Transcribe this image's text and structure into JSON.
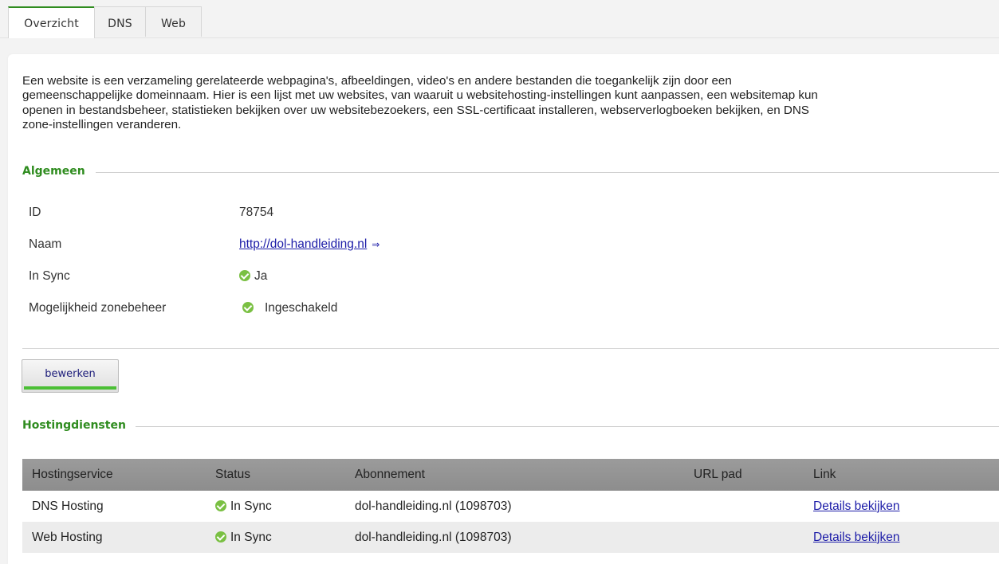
{
  "tabs": [
    "Overzicht",
    "DNS",
    "Web"
  ],
  "description": [
    "Een website is een verzameling gerelateerde webpagina's, afbeeldingen, video's en andere bestanden die toegankelijk zijn door een",
    "gemeenschappelijke domeinnaam. Hier is een lijst met uw websites, van waaruit u websitehosting-instellingen kunt aanpassen, een websitemap kun",
    "openen in bestandsbeheer, statistieken bekijken over uw websitebezoekers, een SSL-certificaat installeren, webserverlogboeken bekijken, en DNS",
    "zone-instellingen veranderen."
  ],
  "general": {
    "title": "Algemeen",
    "id_label": "ID",
    "id_value": "78754",
    "name_label": "Naam",
    "name_value": "http://dol-handleiding.nl",
    "sync_label": "In Sync",
    "sync_value": "Ja",
    "zone_label": "Mogelijkheid zonebeheer",
    "zone_value": "Ingeschakeld"
  },
  "edit_button": "bewerken",
  "hosting": {
    "title": "Hostingdiensten",
    "headers": [
      "Hostingservice",
      "Status",
      "Abonnement",
      "URL pad",
      "Link"
    ],
    "rows": [
      {
        "service": "DNS Hosting",
        "status": "In Sync",
        "subscription": "dol-handleiding.nl (1098703)",
        "url_path": "",
        "link": "Details bekijken"
      },
      {
        "service": "Web Hosting",
        "status": "In Sync",
        "subscription": "dol-handleiding.nl (1098703)",
        "url_path": "",
        "link": "Details bekijken"
      }
    ]
  },
  "colors": {
    "accent": "#2f8c1f",
    "link": "#1c1ca8",
    "status_ok": "#7ac043"
  },
  "icons": [
    "check-circle-icon",
    "external-link-icon"
  ]
}
